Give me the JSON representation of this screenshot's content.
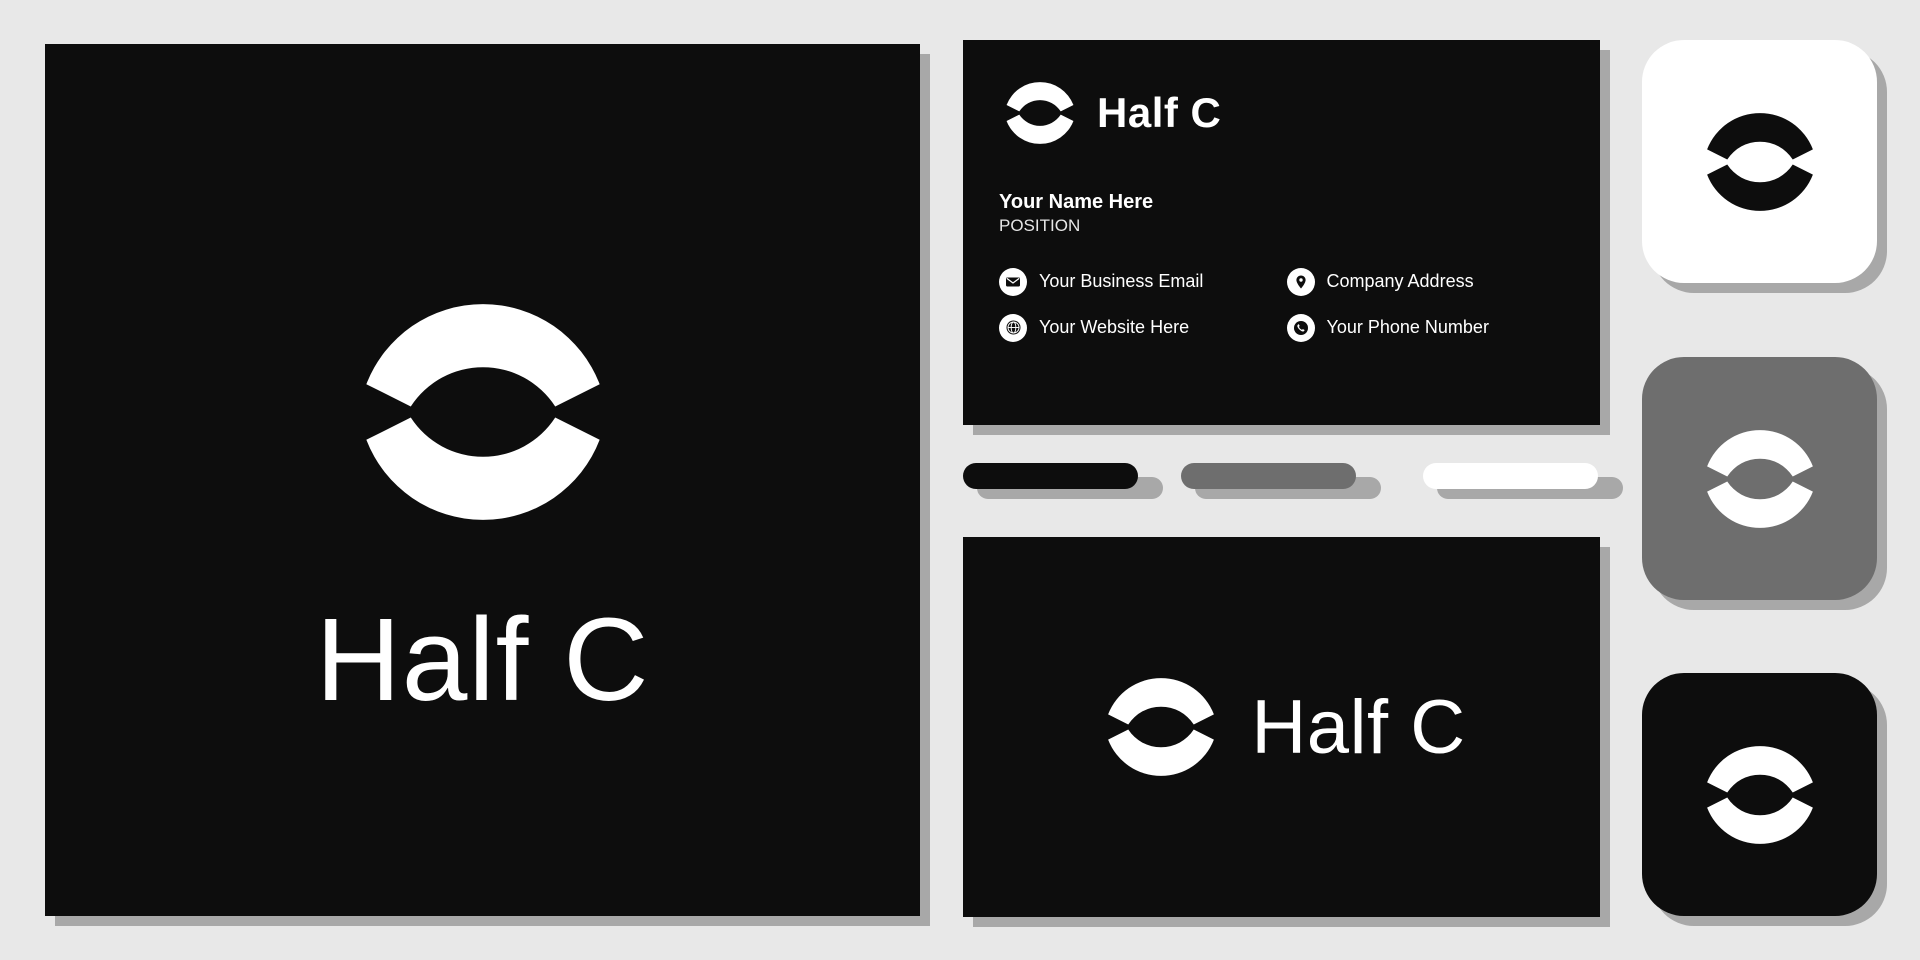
{
  "brand": {
    "name": "Half C",
    "logo_icon": "half-circle-arcs-icon",
    "colors": {
      "black": "#0d0d0d",
      "gray": "#6e6e6e",
      "light_gray": "#a8a8a8",
      "white": "#ffffff",
      "background": "#e8e8e8"
    }
  },
  "main_card": {
    "name": "Half C",
    "background": "#0d0d0d"
  },
  "business_card": {
    "brand": "Half C",
    "person_name": "Your Name Here",
    "position": "POSITION",
    "contacts": [
      {
        "icon": "envelope-icon",
        "label": "Your Business Email"
      },
      {
        "icon": "location-pin-icon",
        "label": "Company Address"
      },
      {
        "icon": "globe-icon",
        "label": "Your Website Here"
      },
      {
        "icon": "phone-icon",
        "label": "Your Phone Number"
      }
    ]
  },
  "swatches": [
    {
      "name": "swatch-black",
      "top_color": "#0d0d0d",
      "bottom_color": "#a8a8a8"
    },
    {
      "name": "swatch-gray",
      "top_color": "#6e6e6e",
      "bottom_color": "#a8a8a8"
    },
    {
      "name": "swatch-white",
      "top_color": "#ffffff",
      "bottom_color": "#a8a8a8"
    }
  ],
  "horizontal_card": {
    "brand": "Half C",
    "background": "#0d0d0d"
  },
  "tiles": [
    {
      "name": "app-icon-white",
      "background": "#ffffff",
      "mark_color": "#0d0d0d"
    },
    {
      "name": "app-icon-gray",
      "background": "#6e6e6e",
      "mark_color": "#ffffff"
    },
    {
      "name": "app-icon-black",
      "background": "#0d0d0d",
      "mark_color": "#ffffff"
    }
  ]
}
